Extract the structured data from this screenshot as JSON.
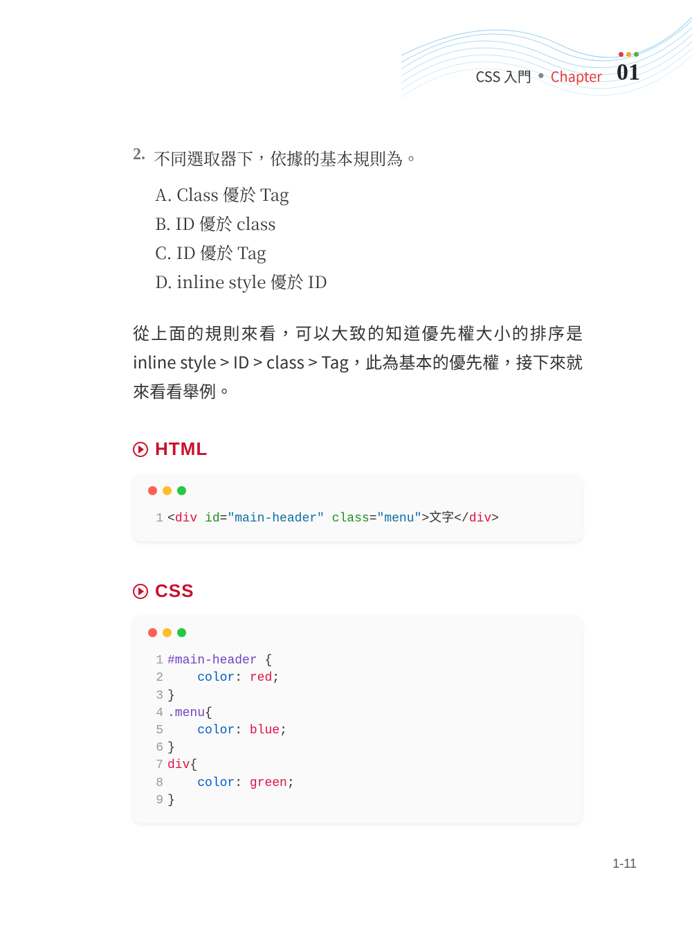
{
  "header": {
    "title": "CSS 入門",
    "chapter_label": "Chapter",
    "chapter_number": "01"
  },
  "list": {
    "number": "2.",
    "title": "不同選取器下，依據的基本規則為。",
    "items": {
      "a": "A. Class 優於 Tag",
      "b": "B. ID 優於 class",
      "c": "C. ID 優於 Tag",
      "d": "D. inline style 優於 ID"
    }
  },
  "paragraph": "從上面的規則來看，可以大致的知道優先權大小的排序是 inline style > ID > class > Tag，此為基本的優先權，接下來就來看看舉例。",
  "section_html": {
    "title": "HTML",
    "code": {
      "line1": {
        "num": "1",
        "t1": "<",
        "tag_open": "div",
        "attr1": " id",
        "eq1": "=",
        "str1": "\"main-header\"",
        "attr2": " class",
        "eq2": "=",
        "str2": "\"menu\"",
        "t2": ">",
        "text": "文字",
        "t3": "</",
        "tag_close": "div",
        "t4": ">"
      }
    }
  },
  "section_css": {
    "title": "CSS",
    "code": {
      "l1": {
        "num": "1",
        "sel": "#main-header",
        "sp": " ",
        "brace": "{"
      },
      "l2": {
        "num": "2",
        "indent": "    ",
        "prop": "color",
        "colon": ": ",
        "val": "red",
        "semi": ";"
      },
      "l3": {
        "num": "3",
        "brace": "}"
      },
      "l4": {
        "num": "4",
        "sel": ".menu",
        "brace": "{"
      },
      "l5": {
        "num": "5",
        "indent": "    ",
        "prop": "color",
        "colon": ": ",
        "val": "blue",
        "semi": ";"
      },
      "l6": {
        "num": "6",
        "brace": "}"
      },
      "l7": {
        "num": "7",
        "sel": "div",
        "brace": "{"
      },
      "l8": {
        "num": "8",
        "indent": "    ",
        "prop": "color",
        "colon": ": ",
        "val": "green",
        "semi": ";"
      },
      "l9": {
        "num": "9",
        "brace": "}"
      }
    }
  },
  "page_number": "1-11"
}
